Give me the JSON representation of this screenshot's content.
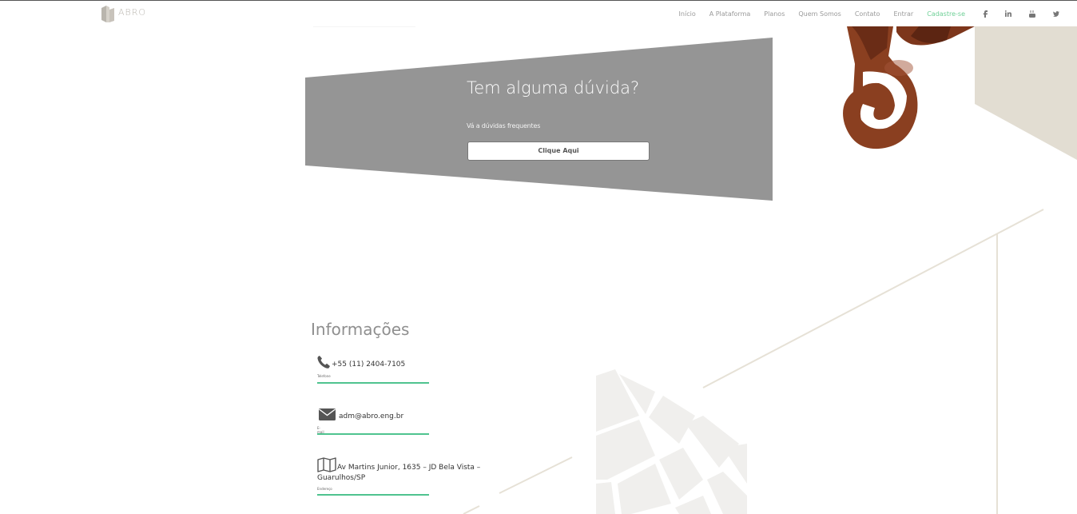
{
  "nav": {
    "logo_text": "ABRO",
    "links": [
      "Início",
      "A Plataforma",
      "Planos",
      "Quem Somos",
      "Contato",
      "Entrar"
    ],
    "cta": "Cadastre-se",
    "social": [
      "facebook-icon",
      "linkedin-icon",
      "youtube-icon",
      "twitter-icon"
    ]
  },
  "faq": {
    "title": "Tem alguma dúvida?",
    "subtitle": "Vá a dúvidas frequentes",
    "button": "Clique Aqui"
  },
  "info": {
    "title": "Informações",
    "phone": {
      "value": "+55 (11) 2404-7105",
      "label": "Telefone"
    },
    "email": {
      "value": "adm@abro.eng.br",
      "label": "E-mail"
    },
    "address": {
      "line1": "Av Martins Junior, 1635 – JD Bela Vista –",
      "line2": "Guarulhos/SP",
      "label": "Endereço"
    }
  },
  "colors": {
    "accent": "#4fc38f",
    "cta": "#6ecf96",
    "faq_bg": "#959595",
    "beige": "#e2ddd2"
  }
}
